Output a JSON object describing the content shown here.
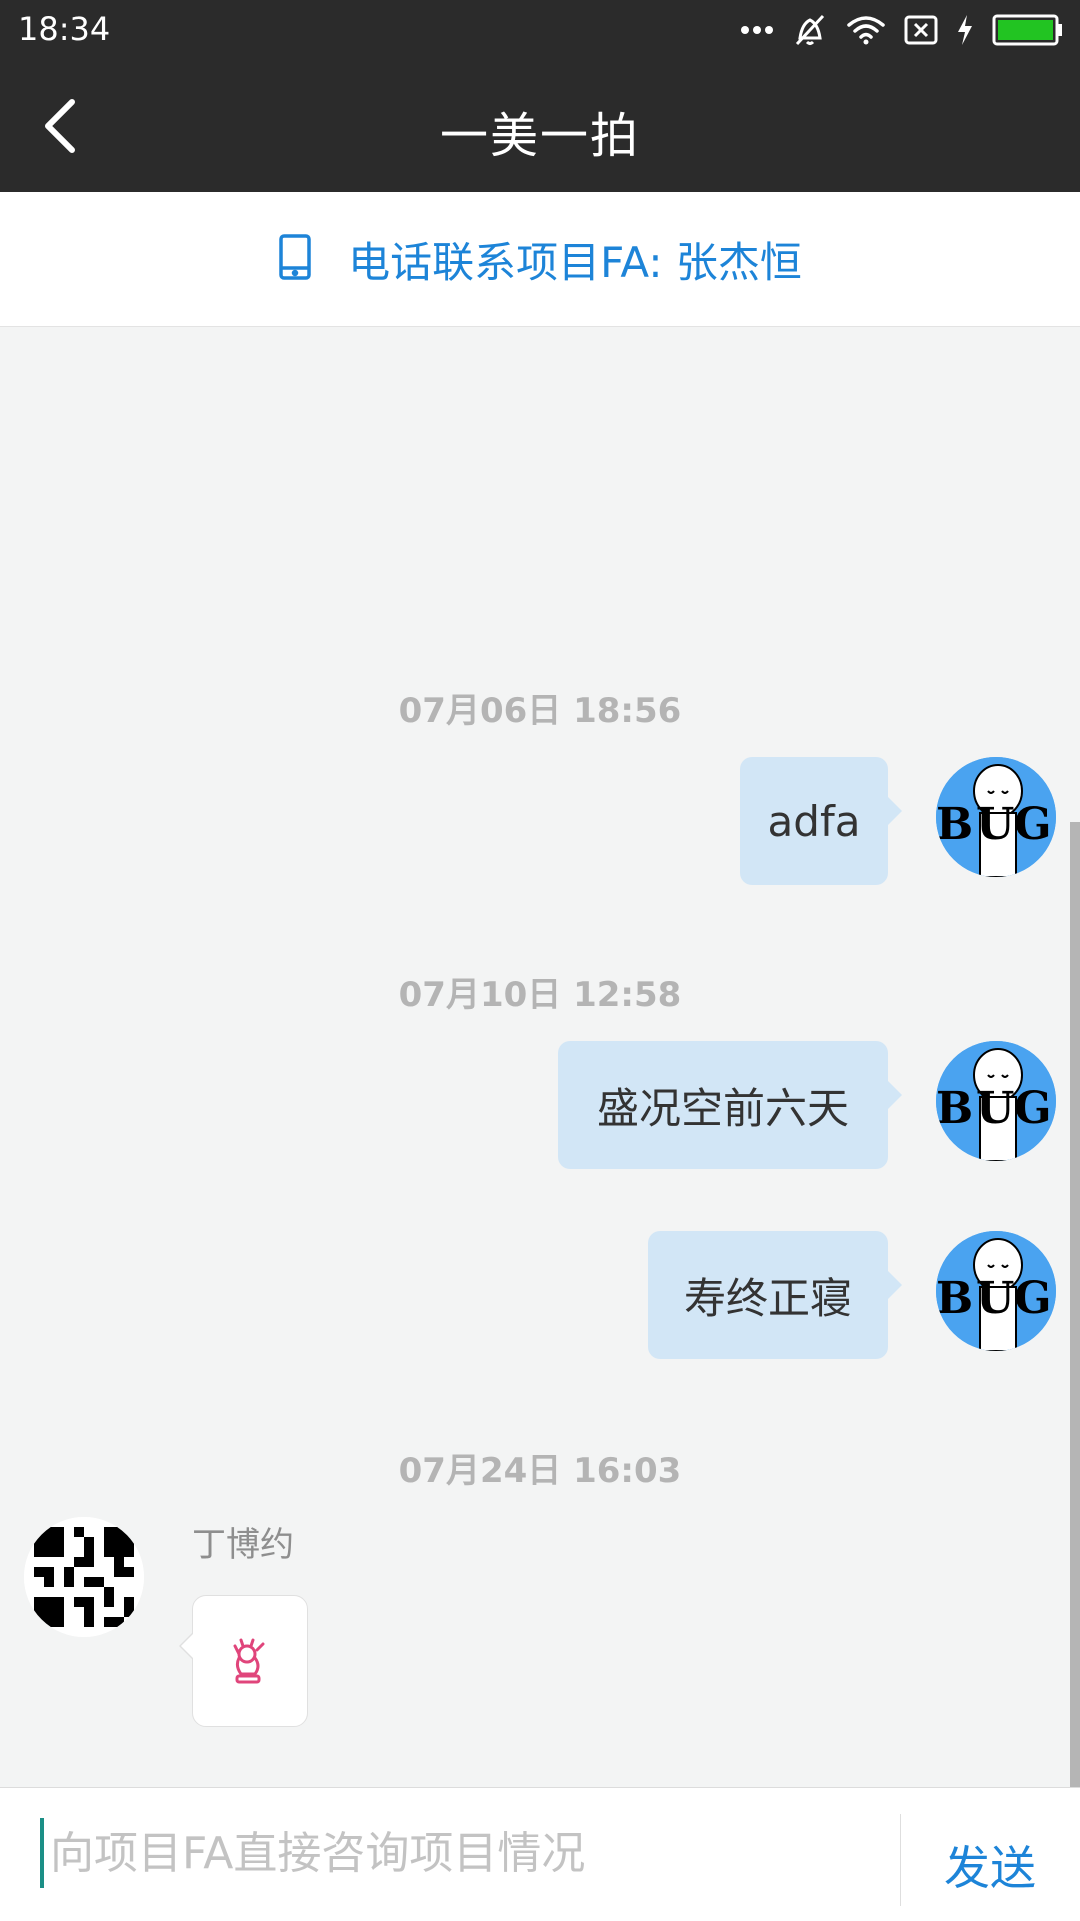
{
  "status": {
    "time": "18:34",
    "icons": [
      "more-dots-icon",
      "vibrate-off-icon",
      "wifi-icon",
      "no-sim-icon",
      "charging-icon",
      "battery-icon"
    ],
    "battery_color": "#22c422"
  },
  "header": {
    "title": "一美一拍",
    "back_icon": "chevron-left-icon"
  },
  "contact": {
    "icon": "phone-icon",
    "label": "电话联系项目FA: 张杰恒"
  },
  "messages": [
    {
      "type": "timestamp",
      "text": "07月06日 18:56"
    },
    {
      "type": "outgoing",
      "text": "adfa",
      "avatar": "bug-avatar"
    },
    {
      "type": "timestamp",
      "text": "07月10日 12:58"
    },
    {
      "type": "outgoing",
      "text": "盛况空前六天",
      "avatar": "bug-avatar"
    },
    {
      "type": "outgoing",
      "text": "寿终正寝",
      "avatar": "bug-avatar"
    },
    {
      "type": "timestamp",
      "text": "07月24日 16:03"
    },
    {
      "type": "incoming",
      "sender": "丁博约",
      "content": "ok-hand-emoji",
      "avatar": "qr-code-avatar"
    }
  ],
  "input": {
    "placeholder": "向项目FA直接咨询项目情况",
    "value": "",
    "send_label": "发送"
  },
  "colors": {
    "header_bg": "#2b2b2b",
    "accent": "#1d84d8",
    "outgoing_bubble": "#d2e6f6",
    "chat_bg": "#f3f4f4"
  }
}
